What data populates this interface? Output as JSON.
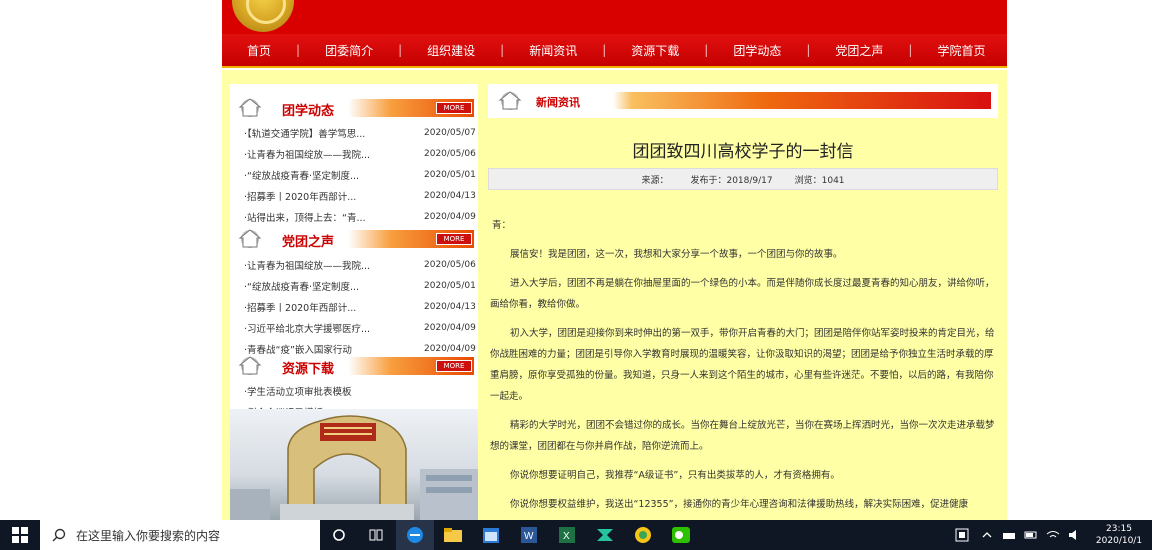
{
  "nav": [
    "首页",
    "团委简介",
    "组织建设",
    "新闻资讯",
    "资源下载",
    "团学动态",
    "党团之声",
    "学院首页"
  ],
  "sections": {
    "tuanxue": {
      "title": "团学动态",
      "more": "MORE",
      "items": [
        {
          "title": "·【轨道交通学院】善学笃思...",
          "date": "2020/05/07"
        },
        {
          "title": "·让青春为祖国绽放——我院...",
          "date": "2020/05/06"
        },
        {
          "title": "·“绽放战疫青春·坚定制度...",
          "date": "2020/05/01"
        },
        {
          "title": "·招募季丨2020年西部计...",
          "date": "2020/04/13"
        },
        {
          "title": "·站得出来，顶得上去：“青...",
          "date": "2020/04/09"
        }
      ]
    },
    "dangtuan": {
      "title": "党团之声",
      "more": "MORE",
      "items": [
        {
          "title": "·让青春为祖国绽放——我院...",
          "date": "2020/05/06"
        },
        {
          "title": "·“绽放战疫青春·坚定制度...",
          "date": "2020/05/01"
        },
        {
          "title": "·招募季丨2020年西部计...",
          "date": "2020/04/13"
        },
        {
          "title": "·习近平给北京大学援鄂医疗...",
          "date": "2020/04/09"
        },
        {
          "title": "·青春战“疫”嵌入国家行动",
          "date": "2020/04/09"
        }
      ]
    },
    "ziyuan": {
      "title": "资源下载",
      "more": "MORE",
      "items": [
        {
          "title": "·学生活动立项审批表模板",
          "date": ""
        },
        {
          "title": "·例会会议记录模板",
          "date": ""
        }
      ]
    }
  },
  "news": {
    "tab": "新闻资讯",
    "title": "团团致四川高校学子的一封信",
    "meta": {
      "source": "来源：",
      "published": "发布于：2018/9/17",
      "views": "浏览：1041"
    },
    "greeting": "青：",
    "paragraphs": [
      "展信安！我是团团，这一次，我想和大家分享一个故事，一个团团与你的故事。",
      "进入大学后，团团不再是躺在你抽屉里面的一个绿色的小本。而是伴随你成长度过最夏青春的知心朋友，讲给你听，画给你看，教给你做。",
      "初入大学，团团是迎接你到来时伸出的第一双手，带你开启青春的大门；团团是陪伴你站军姿时投来的肯定目光，给你战胜困难的力量；团团是引导你入学教育时展现的温暖笑容，让你汲取知识的渴望；团团是给予你独立生活时承载的厚重肩膀，原你享受孤独的份量。我知道，只身一人来到这个陌生的城市，心里有些许迷茫。不要怕，以后的路，有我陪你一起走。",
      "精彩的大学时光，团团不会错过你的成长。当你在舞台上绽放光芒，当你在赛场上挥洒时光，当你一次次走进承载梦想的课堂，团团都在与你并肩作战，陪你逆流而上。",
      "你说你想要证明自己，我推荐“A级证书”，只有出类拔萃的人，才有资格拥有。",
      "你说你想要权益维护，我送出“12355”，接通你的青少年心理咨询和法律援助热线，解决实际困难，促进健康"
    ]
  },
  "taskbar": {
    "search_placeholder": "在这里输入你要搜索的内容",
    "time": "23:15",
    "date": "2020/10/1"
  }
}
